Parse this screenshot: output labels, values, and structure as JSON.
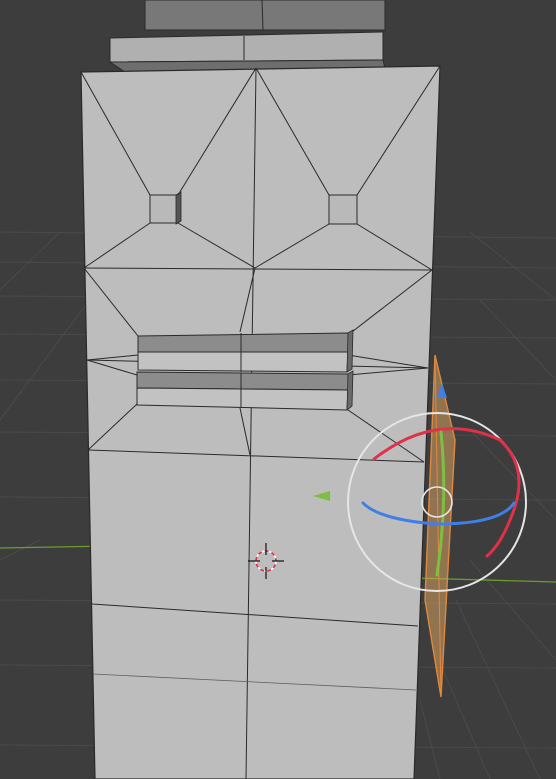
{
  "viewport": {
    "mode": "3d-viewport",
    "background_color": "#3d3d3d",
    "grid_color": "#4a4a4a",
    "x_axis_color": "#b04355",
    "y_axis_color": "#6a9c2f"
  },
  "mesh": {
    "face_color": "#bdbdbd",
    "face_shaded_color": "#8c8c8c",
    "edge_color": "#2a2a2a",
    "selected_object_color": "#e0893c"
  },
  "gizmo": {
    "type": "rotate",
    "x_color": "#e0314a",
    "y_color": "#7bc043",
    "z_color": "#3f7fe6",
    "view_ring_color": "#e6e6e6"
  },
  "cursor": {
    "icon": "3d-cursor-icon"
  }
}
